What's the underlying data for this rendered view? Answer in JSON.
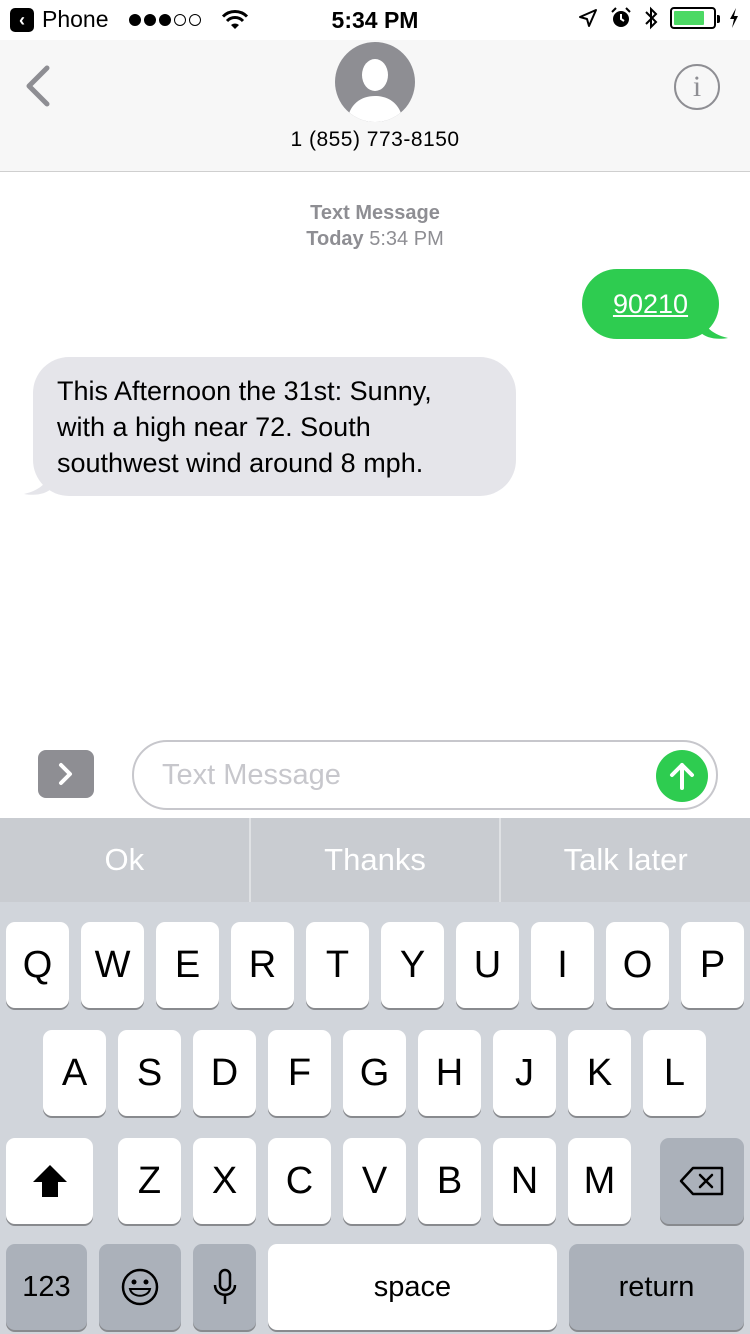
{
  "status_bar": {
    "back_app": "Phone",
    "time": "5:34 PM",
    "battery_level": 0.8
  },
  "header": {
    "contact": "1 (855) 773-8150",
    "info_label": "i"
  },
  "conversation": {
    "service": "Text Message",
    "day": "Today",
    "time": "5:34 PM",
    "messages": [
      {
        "direction": "outgoing",
        "text": "90210"
      },
      {
        "direction": "incoming",
        "lines": [
          "This Afternoon the 31st: Sunny,",
          "with a high near 72. South",
          "southwest wind around 8 mph."
        ]
      }
    ]
  },
  "composer": {
    "placeholder": "Text Message"
  },
  "quick_replies": [
    "Ok",
    "Thanks",
    "Talk later"
  ],
  "keyboard": {
    "row1": [
      "Q",
      "W",
      "E",
      "R",
      "T",
      "Y",
      "U",
      "I",
      "O",
      "P"
    ],
    "row2": [
      "A",
      "S",
      "D",
      "F",
      "G",
      "H",
      "J",
      "K",
      "L"
    ],
    "row3": [
      "Z",
      "X",
      "C",
      "V",
      "B",
      "N",
      "M"
    ],
    "numbers_key": "123",
    "space_key": "space",
    "return_key": "return"
  },
  "colors": {
    "imessage_green": "#2ecc50",
    "incoming_bubble": "#e5e5ea",
    "keyboard_bg": "#d1d5db"
  }
}
